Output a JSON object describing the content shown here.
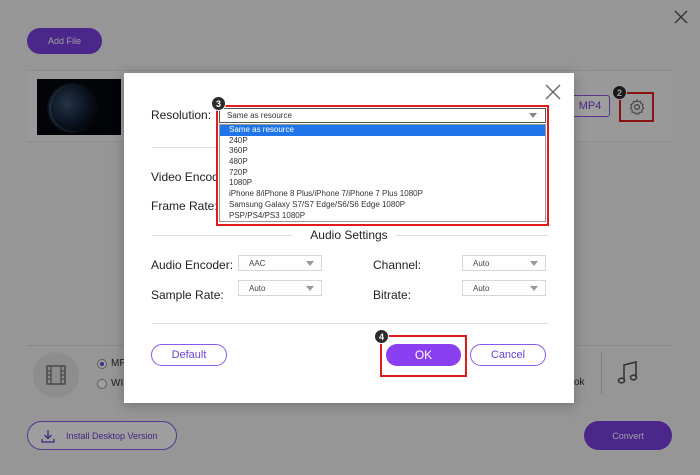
{
  "toolbar": {
    "add_file_label": "Add File"
  },
  "file": {
    "format_label": "MP4"
  },
  "badges": {
    "gear": "2",
    "resolution": "3",
    "ok": "4"
  },
  "output": {
    "radio_1": "MP",
    "radio_2": "WI",
    "right_fragment": "ok"
  },
  "footer": {
    "install_label": "Install Desktop Version",
    "convert_label": "Convert"
  },
  "dialog": {
    "resolution_label": "Resolution:",
    "resolution_value": "Same as resource",
    "resolution_options": [
      "Same as resource",
      "240P",
      "360P",
      "480P",
      "720P",
      "1080P",
      "iPhone 8/iPhone 8 Plus/iPhone 7/iPhone 7 Plus 1080P",
      "Samsung Galaxy S7/S7 Edge/S6/S6 Edge 1080P",
      "PSP/PS4/PS3 1080P"
    ],
    "video_encoder_label": "Video Encode",
    "frame_rate_label": "Frame Rate:",
    "audio_section_title": "Audio Settings",
    "audio_encoder_label": "Audio Encoder:",
    "audio_encoder_value": "AAC",
    "channel_label": "Channel:",
    "channel_value": "Auto",
    "sample_rate_label": "Sample Rate:",
    "sample_rate_value": "Auto",
    "bitrate_label": "Bitrate:",
    "bitrate_value": "Auto",
    "default_label": "Default",
    "ok_label": "OK",
    "cancel_label": "Cancel"
  },
  "colors": {
    "accent": "#7a3fe0",
    "highlight_red": "#e01b1b",
    "selected_option": "#1e74e8"
  },
  "icons": {
    "close": "close-icon",
    "gear": "gear-icon",
    "film": "film-icon",
    "music": "music-note-icon",
    "download": "download-icon"
  }
}
